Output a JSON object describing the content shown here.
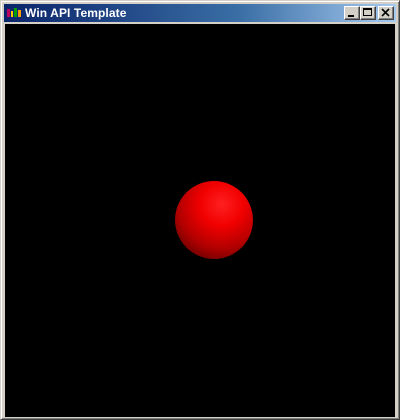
{
  "window": {
    "title": "Win API Template",
    "icon": "application-icon",
    "controls": {
      "minimize": "minimize-icon",
      "maximize": "maximize-icon",
      "close": "close-icon"
    }
  },
  "scene": {
    "background_color": "#000000",
    "object": "sphere",
    "object_color": "#ff0000"
  }
}
